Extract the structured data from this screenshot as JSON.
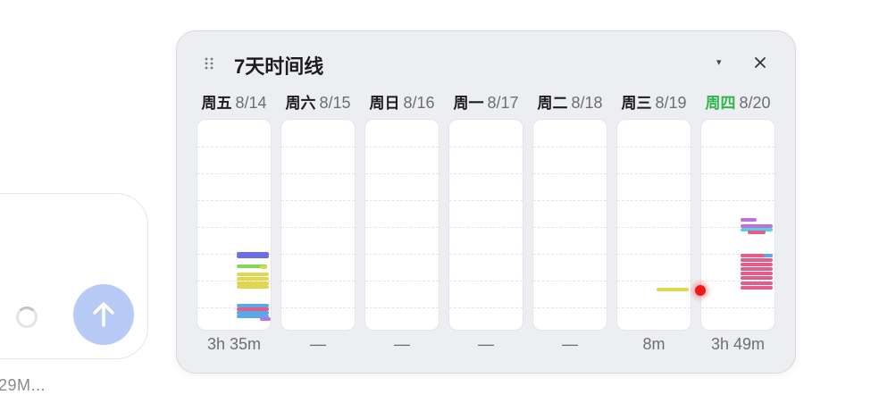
{
  "composer": {
    "bottom_text": "29M..."
  },
  "widget": {
    "title": "7天时间线",
    "dropdown_glyph": "▾",
    "days": [
      {
        "weekday": "周五",
        "date": "8/14",
        "total": "3h 35m",
        "today": false
      },
      {
        "weekday": "周六",
        "date": "8/15",
        "total": "—",
        "today": false
      },
      {
        "weekday": "周日",
        "date": "8/16",
        "total": "—",
        "today": false
      },
      {
        "weekday": "周一",
        "date": "8/17",
        "total": "—",
        "today": false
      },
      {
        "weekday": "周二",
        "date": "8/18",
        "total": "—",
        "today": false
      },
      {
        "weekday": "周三",
        "date": "8/19",
        "total": "8m",
        "today": false
      },
      {
        "weekday": "周四",
        "date": "8/20",
        "total": "3h 49m",
        "today": true
      }
    ]
  },
  "colors": {
    "send_button": "#b7c9f5",
    "today_label": "#2fb54a",
    "now_indicator": "#f01818",
    "event_blue": "#6b6fe0",
    "event_green": "#7ed957",
    "event_yellow": "#e3d64f",
    "event_sky": "#5aa8e6",
    "event_pink": "#e35d8a",
    "event_purple": "#c36ee0",
    "event_cyan": "#56d0e0"
  }
}
